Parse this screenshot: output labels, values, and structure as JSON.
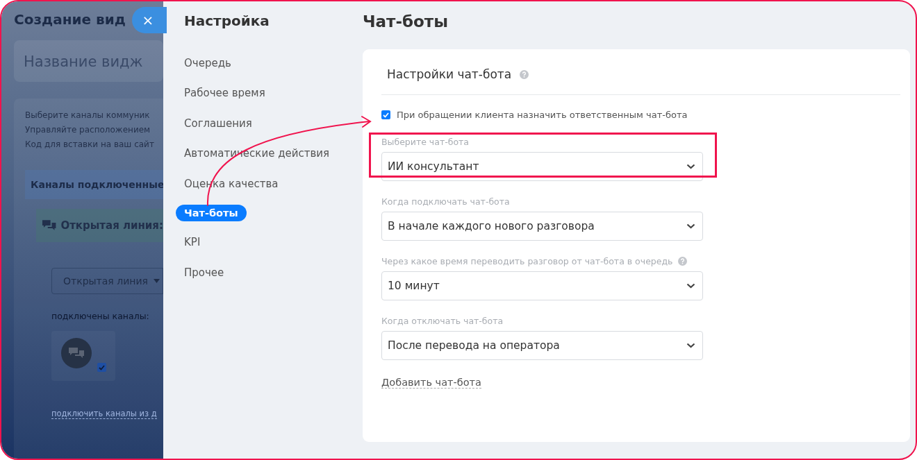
{
  "background_page": {
    "title": "Создание вид",
    "name_field": {
      "value": "Название видж"
    },
    "description": [
      "Выберите каналы коммуник",
      "Управляйте расположением",
      "Код для вставки на ваш сайт"
    ],
    "channels_header": "Каналы подключенные",
    "open_line": {
      "title": "Открытая линия:",
      "dropdown": "Открытая линия",
      "connected_label": "подключены каналы:",
      "channel_checked": true,
      "connect_link": "подключить каналы из д"
    }
  },
  "close_button": {
    "label": "×"
  },
  "sidebar": {
    "title": "Настройка",
    "items": [
      {
        "label": "Очередь",
        "selected": false
      },
      {
        "label": "Рабочее время",
        "selected": false
      },
      {
        "label": "Соглашения",
        "selected": false
      },
      {
        "label": "Автоматические действия",
        "selected": false
      },
      {
        "label": "Оценка качества",
        "selected": false
      },
      {
        "label": "Чат-боты",
        "selected": true
      },
      {
        "label": "KPI",
        "selected": false
      },
      {
        "label": "Прочее",
        "selected": false
      }
    ]
  },
  "main": {
    "title": "Чат-боты",
    "card": {
      "title": "Настройки чат-бота",
      "assign_checkbox": {
        "label": "При обращении клиента назначить ответственным чат-бота",
        "checked": true
      },
      "fields": [
        {
          "label": "Выберите чат-бота",
          "value": "ИИ консультант",
          "help": false,
          "highlighted": true
        },
        {
          "label": "Когда подключать чат-бота",
          "value": "В начале каждого нового разговора",
          "help": false,
          "highlighted": false
        },
        {
          "label": "Через какое время переводить разговор от чат-бота в очередь",
          "value": "10 минут",
          "help": true,
          "highlighted": false
        },
        {
          "label": "Когда отключать чат-бота",
          "value": "После перевода на оператора",
          "help": false,
          "highlighted": false
        }
      ],
      "add_link": "Добавить чат-бота"
    }
  }
}
